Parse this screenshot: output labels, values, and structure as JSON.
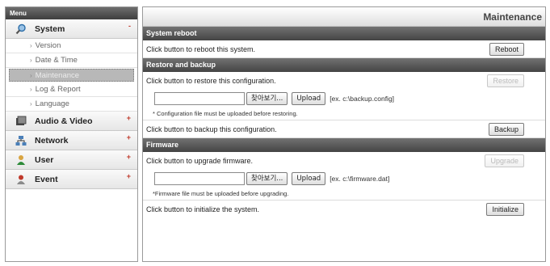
{
  "sidebar": {
    "header": "Menu",
    "system": {
      "label": "System",
      "mark": "-",
      "items": [
        "Version",
        "Date & Time",
        "Maintenance",
        "Log & Report",
        "Language"
      ]
    },
    "categories": [
      {
        "label": "Audio & Video",
        "mark": "+"
      },
      {
        "label": "Network",
        "mark": "+"
      },
      {
        "label": "User",
        "mark": "+"
      },
      {
        "label": "Event",
        "mark": "+"
      }
    ]
  },
  "main": {
    "title": "Maintenance",
    "reboot": {
      "heading": "System reboot",
      "text": "Click button to reboot this system.",
      "button": "Reboot"
    },
    "restore": {
      "heading": "Restore and backup",
      "text": "Click button to restore this configuration.",
      "button": "Restore",
      "browse": "찾아보기...",
      "upload": "Upload",
      "example": "[ex. c:\\backup.config]",
      "note": "* Configuration file must be uploaded before restoring.",
      "backup_text": "Click button to backup this configuration.",
      "backup_button": "Backup"
    },
    "firmware": {
      "heading": "Firmware",
      "text": "Click button to upgrade firmware.",
      "button": "Upgrade",
      "browse": "찾아보기...",
      "upload": "Upload",
      "example": "[ex. c:\\firmware.dat]",
      "note": "*Firmware file must be uploaded before upgrading.",
      "init_text": "Click button to initialize the system.",
      "init_button": "Initialize"
    }
  }
}
